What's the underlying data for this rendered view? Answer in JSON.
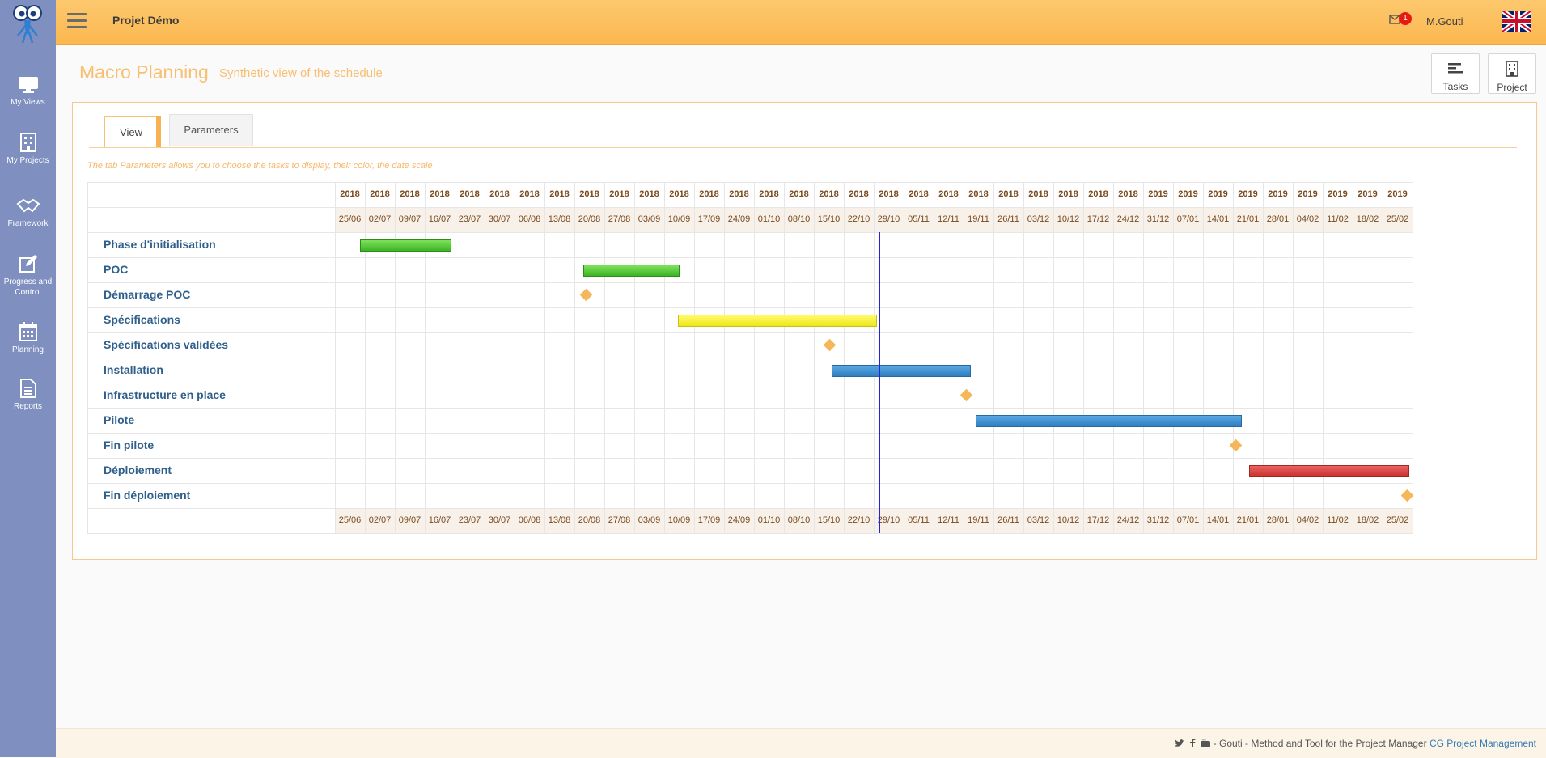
{
  "header": {
    "project_name": "Projet Démo",
    "notification_count": "1",
    "user_name": "M.Gouti"
  },
  "sidebar": {
    "items": [
      {
        "label": "My Views",
        "icon": "monitor-icon"
      },
      {
        "label": "My Projects",
        "icon": "building-icon"
      },
      {
        "label": "Framework",
        "icon": "handshake-icon"
      },
      {
        "label": "Progress and Control",
        "icon": "edit-icon"
      },
      {
        "label": "Planning",
        "icon": "calendar-icon"
      },
      {
        "label": "Reports",
        "icon": "document-icon"
      }
    ]
  },
  "page": {
    "title": "Macro Planning",
    "subtitle": "Synthetic view of the schedule",
    "buttons": {
      "tasks": "Tasks",
      "project": "Project"
    }
  },
  "tabs": {
    "view": "View",
    "parameters": "Parameters"
  },
  "hint": "The tab Parameters allows you to choose the tasks to display, their color, the date scale",
  "gantt": {
    "years": [
      "2018",
      "2018",
      "2018",
      "2018",
      "2018",
      "2018",
      "2018",
      "2018",
      "2018",
      "2018",
      "2018",
      "2018",
      "2018",
      "2018",
      "2018",
      "2018",
      "2018",
      "2018",
      "2018",
      "2018",
      "2018",
      "2018",
      "2018",
      "2018",
      "2018",
      "2018",
      "2018",
      "2019",
      "2019",
      "2019",
      "2019",
      "2019",
      "2019",
      "2019",
      "2019",
      "2019"
    ],
    "weeks": [
      "25/06",
      "02/07",
      "09/07",
      "16/07",
      "23/07",
      "30/07",
      "06/08",
      "13/08",
      "20/08",
      "27/08",
      "03/09",
      "10/09",
      "17/09",
      "24/09",
      "01/10",
      "08/10",
      "15/10",
      "22/10",
      "29/10",
      "05/11",
      "12/11",
      "19/11",
      "26/11",
      "03/12",
      "10/12",
      "17/12",
      "24/12",
      "31/12",
      "07/01",
      "14/01",
      "21/01",
      "28/01",
      "04/02",
      "11/02",
      "18/02",
      "25/02"
    ],
    "today_week": 18.2,
    "tasks": [
      {
        "name": "Phase d'initialisation",
        "type": "bar",
        "color": "green",
        "start": 0.85,
        "end": 3.85
      },
      {
        "name": "POC",
        "type": "bar",
        "color": "green",
        "start": 8.3,
        "end": 11.45
      },
      {
        "name": "Démarrage POC",
        "type": "milestone",
        "at": 8.4
      },
      {
        "name": "Spécifications",
        "type": "bar",
        "color": "yellow",
        "start": 11.45,
        "end": 18.05
      },
      {
        "name": "Spécifications validées",
        "type": "milestone",
        "at": 16.55
      },
      {
        "name": "Installation",
        "type": "bar",
        "color": "blue",
        "start": 16.6,
        "end": 21.2
      },
      {
        "name": "Infrastructure en place",
        "type": "milestone",
        "at": 21.1
      },
      {
        "name": "Pilote",
        "type": "bar",
        "color": "blue",
        "start": 21.4,
        "end": 30.25
      },
      {
        "name": "Fin pilote",
        "type": "milestone",
        "at": 30.1
      },
      {
        "name": "Déploiement",
        "type": "bar",
        "color": "red",
        "start": 30.55,
        "end": 35.85
      },
      {
        "name": "Fin déploiement",
        "type": "milestone",
        "at": 35.85
      }
    ]
  },
  "footer": {
    "text": "- Gouti - Method and Tool for the Project Manager",
    "link": "CG Project Management"
  }
}
